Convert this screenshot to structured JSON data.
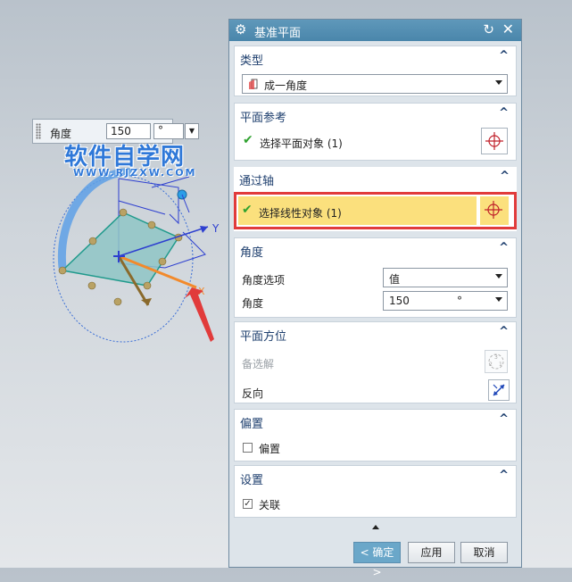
{
  "floating_input": {
    "label": "角度",
    "value": "150",
    "unit": "°"
  },
  "watermark": {
    "cn": "软件自学网",
    "en": "WWW.RJZXW.COM"
  },
  "axis_labels": {
    "y": "Y",
    "x": "X"
  },
  "dialog": {
    "title": "基准平面",
    "sections": {
      "type": {
        "header": "类型",
        "selected": "成一角度"
      },
      "plane_ref": {
        "header": "平面参考",
        "item": "选择平面对象 (1)"
      },
      "through_axis": {
        "header": "通过轴",
        "item": "选择线性对象 (1)"
      },
      "angle": {
        "header": "角度",
        "option_label": "角度选项",
        "option_value": "值",
        "angle_label": "角度",
        "angle_value": "150",
        "angle_unit": "°"
      },
      "plane_orient": {
        "header": "平面方位",
        "alternate": "备选解",
        "reverse": "反向"
      },
      "offset": {
        "header": "偏置",
        "checkbox": "偏置",
        "checked": false
      },
      "settings": {
        "header": "设置",
        "checkbox": "关联",
        "checked": true
      }
    },
    "buttons": {
      "ok": "< 确定 >",
      "apply": "应用",
      "cancel": "取消"
    }
  },
  "colors": {
    "title_bar": "#4a86ab",
    "section_header": "#1e3f6e",
    "highlight": "#fbe07d",
    "callout": "#e13b3b",
    "plane_fill": "#8fc5c5"
  }
}
